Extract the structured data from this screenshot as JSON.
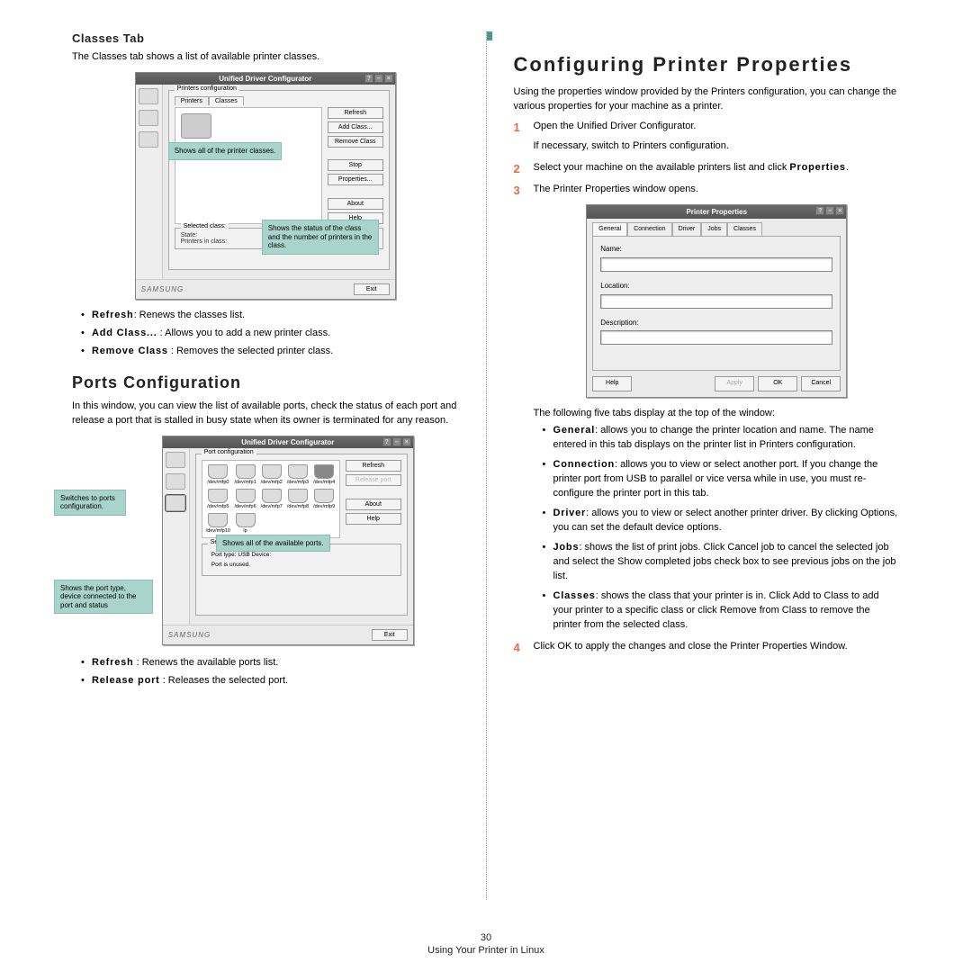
{
  "left": {
    "classes_heading": "Classes Tab",
    "classes_intro": "The Classes tab shows a list of available printer classes.",
    "classes_window": {
      "title": "Unified Driver Configurator",
      "fieldset": "Printers configuration",
      "tabs": [
        "Printers",
        "Classes"
      ],
      "buttons": [
        "Refresh",
        "Add Class...",
        "Remove Class",
        "Stop",
        "Properties...",
        "About",
        "Help"
      ],
      "sel_fieldset": "Selected class:",
      "sel_state": "State:",
      "sel_count": "Printers in class:",
      "brand": "SAMSUNG",
      "exit": "Exit",
      "callout_all": "Shows all of the printer classes.",
      "callout_status": "Shows the status of the class and the number of printers in the class."
    },
    "classes_bullets": [
      {
        "t": "Refresh",
        "d": ": Renews the classes list."
      },
      {
        "t": "Add Class...",
        "d": " : Allows you to add a new printer class."
      },
      {
        "t": "Remove Class",
        "d": " : Removes the selected printer class."
      }
    ],
    "ports_heading": "Ports Configuration",
    "ports_intro": "In this window, you can view the list of available ports, check the status of each port and release a port that is stalled in busy state when its owner is terminated for any reason.",
    "ports_window": {
      "title": "Unified Driver Configurator",
      "fieldset": "Port configuration",
      "buttons": [
        "Refresh",
        "Release port",
        "About",
        "Help"
      ],
      "port_labels": [
        "/dev/mfp0",
        "/dev/mfp1",
        "/dev/mfp2",
        "/dev/mfp3",
        "/dev/mfp4",
        "/dev/mfp5",
        "/dev/mfp6",
        "/dev/mfp7",
        "/dev/mfp8",
        "/dev/mfp9",
        "/dev/mfp10",
        "lp"
      ],
      "selected_fieldset": "Selected port:",
      "port_type": "Port type: USB   Device:",
      "port_status": "Port is unused.",
      "brand": "SAMSUNG",
      "exit": "Exit",
      "callout_switch": "Switches to ports configuration.",
      "callout_all": "Shows all of the available ports.",
      "callout_info": "Shows the port type, device connected to the port and status"
    },
    "ports_bullets": [
      {
        "t": "Refresh",
        "d": " : Renews the available ports list."
      },
      {
        "t": "Release port",
        "d": " : Releases the selected port."
      }
    ]
  },
  "right": {
    "heading": "Configuring Printer Properties",
    "intro": "Using the properties window provided by the Printers configuration, you can change the various properties for your machine as a printer.",
    "steps": [
      {
        "n": "1",
        "text": "Open the Unified Driver Configurator.",
        "sub": "If necessary, switch to Printers configuration."
      },
      {
        "n": "2",
        "text_pre": "Select your machine on the available printers list and click ",
        "term": "Properties",
        "text_post": "."
      },
      {
        "n": "3",
        "text": "The Printer Properties window opens."
      }
    ],
    "pp_window": {
      "title": "Printer Properties",
      "tabs": [
        "General",
        "Connection",
        "Driver",
        "Jobs",
        "Classes"
      ],
      "fields": [
        "Name:",
        "Location:",
        "Description:"
      ],
      "footer": {
        "help": "Help",
        "apply": "Apply",
        "ok": "OK",
        "cancel": "Cancel"
      }
    },
    "after_window": "The following five tabs display at the top of the window:",
    "tab_descs": [
      {
        "t": "General",
        "d": ": allows you to change the printer location and name. The name entered in this tab displays on the printer list in Printers configuration."
      },
      {
        "t": "Connection",
        "d": ": allows you to view or select another port. If you change the printer port from USB to parallel or vice versa while in use, you must re-configure the printer port in this tab."
      },
      {
        "t": "Driver",
        "d": ": allows you to view or select another printer driver. By clicking Options, you can set the default device options."
      },
      {
        "t": "Jobs",
        "d": ": shows the list of print jobs. Click Cancel job to cancel the selected job and select the Show completed jobs check box to see previous jobs on the job list."
      },
      {
        "t": "Classes",
        "d": ": shows the class that your printer is in. Click Add to Class to add your printer to a specific class or click Remove from Class to remove the printer from the selected class."
      }
    ],
    "step4": {
      "n": "4",
      "text": "Click OK to apply the changes and close the Printer Properties Window."
    }
  },
  "footer": {
    "page_num": "30",
    "chapter": "Using Your Printer in Linux"
  }
}
